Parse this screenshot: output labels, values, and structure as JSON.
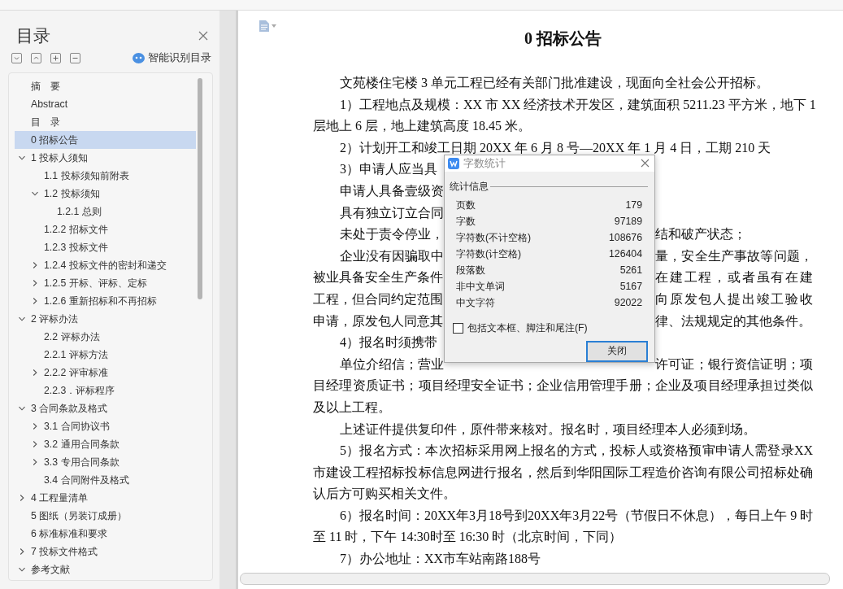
{
  "outline_panel": {
    "title": "目录",
    "smart_button": "智能识别目录",
    "items": [
      {
        "label": "摘　要",
        "selected": false
      },
      {
        "label": "Abstract",
        "selected": false
      },
      {
        "label": "目　录",
        "selected": false
      },
      {
        "label": "0  招标公告",
        "selected": true
      },
      {
        "label": "1  投标人须知",
        "selected": false,
        "expanded": true,
        "children": [
          {
            "label": "1.1 投标须知前附表",
            "selected": false
          },
          {
            "label": "1.2 投标须知",
            "selected": false,
            "expanded": true,
            "children": [
              {
                "label": "1.2.1 总则",
                "selected": false
              }
            ]
          },
          {
            "label": "1.2.2 招标文件",
            "selected": false
          },
          {
            "label": "1.2.3 投标文件",
            "selected": false
          },
          {
            "label": "1.2.4 投标文件的密封和递交",
            "selected": false,
            "expanded": false
          },
          {
            "label": "1.2.5 开标、评标、定标",
            "selected": false,
            "expanded": false
          },
          {
            "label": "1.2.6 重新招标和不再招标",
            "selected": false,
            "expanded": false
          }
        ]
      },
      {
        "label": "2 评标办法",
        "selected": false,
        "expanded": true,
        "children": [
          {
            "label": "2.2 评标办法",
            "selected": false
          },
          {
            "label": "2.2.1 评标方法",
            "selected": false
          },
          {
            "label": "2.2.2 评审标准",
            "selected": false,
            "expanded": false
          },
          {
            "label": "2.2.3．评标程序",
            "selected": false
          }
        ]
      },
      {
        "label": "3 合同条款及格式",
        "selected": false,
        "expanded": true,
        "children": [
          {
            "label": "3.1  合同协议书",
            "selected": false,
            "expanded": false
          },
          {
            "label": "3.2  通用合同条款",
            "selected": false,
            "expanded": false
          },
          {
            "label": "3.3  专用合同条款",
            "selected": false,
            "expanded": false
          },
          {
            "label": "3.4  合同附件及格式",
            "selected": false
          }
        ]
      },
      {
        "label": "4 工程量清单",
        "selected": false,
        "expanded": false
      },
      {
        "label": "5 图纸（另装订成册）",
        "selected": false
      },
      {
        "label": "6  标准标准和要求",
        "selected": false
      },
      {
        "label": "7 投标文件格式",
        "selected": false,
        "expanded": false
      },
      {
        "label": "参考文献",
        "selected": false,
        "expanded": true
      }
    ]
  },
  "document": {
    "title": "0  招标公告",
    "paragraphs": [
      {
        "lines": [
          "文苑楼住宅楼 3 单元工程已经有关部门批准建设，现面向全社会公开招标。"
        ]
      },
      {
        "lines": [
          "1）工程地点及规模：XX 市 XX 经济技术开发区，建筑面积 5211.23 平方米，地下 1",
          "层地上 6 层，地上建筑高度 18.45 米。"
        ]
      },
      {
        "lines": [
          "2）计划开工和竣工日期 20XX 年 6 月 8 号—20XX 年 1 月 4 日，工期 210 天"
        ]
      },
      {
        "lines": [
          {
            "left": "3）申请人应当具"
          }
        ]
      },
      {
        "lines": [
          {
            "left": "申请人具备壹级资"
          }
        ]
      },
      {
        "lines": [
          {
            "left": "具有独立订立合同"
          }
        ]
      },
      {
        "lines": [
          {
            "left": "未处于责令停业，",
            "right": "结和破产状态；"
          }
        ]
      },
      {
        "lines": [
          {
            "left": "企业没有因骗取中",
            "right": "量，安全生产事故等问题，"
          },
          {
            "left": "被业具备安全生产条件",
            "right": "在建工程，或者虽有在建"
          },
          {
            "left": "工程，但合同约定范围",
            "right": "向原发包人提出竣工验收"
          },
          {
            "left": "申请，原发包人同意其",
            "right": "律、法规规定的其他条件。"
          }
        ]
      },
      {
        "lines": [
          {
            "left": "4）报名时须携带"
          }
        ]
      },
      {
        "lines": [
          {
            "left": "单位介绍信；营业",
            "right": "许可证；银行资信证明；项"
          },
          "目经理资质证书；项目经理安全证书；企业信用管理手册；企业及项目经理承担过类似",
          "及以上工程。"
        ]
      },
      {
        "lines": [
          "上述证件提供复印件，原件带来核对。报名时，项目经理本人必须到场。"
        ]
      },
      {
        "lines": [
          "5）报名方式：本次招标采用网上报名的方式，投标人或资格预审申请人需登录XX",
          "市建设工程招标投标信息网进行报名，然后到华阳国际工程造价咨询有限公司招标处确",
          "认后方可购买相关文件。"
        ]
      },
      {
        "lines": [
          "6）报名时间：20XX年3月18号到20XX年3月22号（节假日不休息），每日上午  9  时",
          "至  11  时，下午  14:30时至  16:30  时（北京时间，下同）"
        ]
      },
      {
        "lines": [
          "7）办公地址：XX市车站南路188号"
        ]
      }
    ]
  },
  "dialog": {
    "title": "字数统计",
    "group": "统计信息",
    "stats": [
      {
        "label": "页数",
        "value": "179"
      },
      {
        "label": "字数",
        "value": "97189"
      },
      {
        "label": "字符数(不计空格)",
        "value": "108676"
      },
      {
        "label": "字符数(计空格)",
        "value": "126404"
      },
      {
        "label": "段落数",
        "value": "5261"
      },
      {
        "label": "非中文单词",
        "value": "5167"
      },
      {
        "label": "中文字符",
        "value": "92022"
      }
    ],
    "include_checkbox": {
      "label": "包括文本框、脚注和尾注(F)",
      "checked": false
    },
    "close_button": "关闭"
  }
}
